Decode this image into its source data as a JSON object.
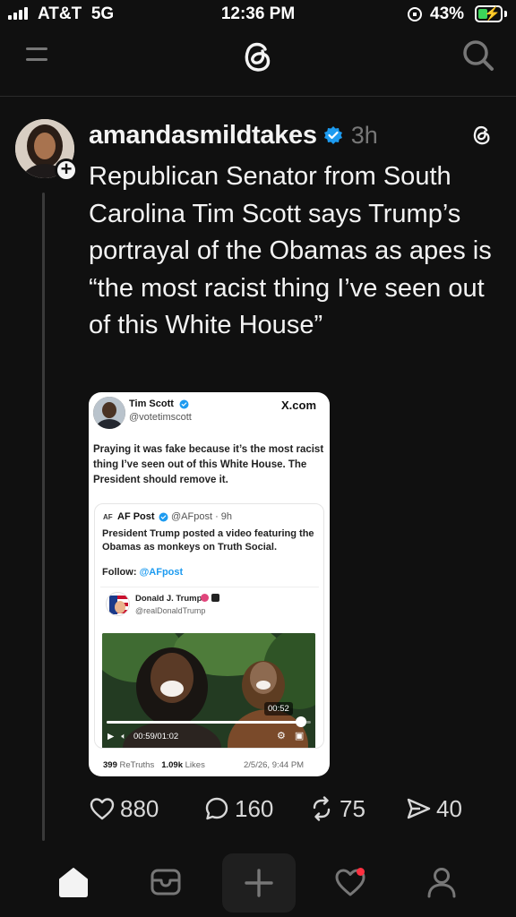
{
  "status_bar": {
    "carrier": "AT&T",
    "network": "5G",
    "time": "12:36 PM",
    "battery_pct": "43%",
    "battery_level": 0.43,
    "signal_icon": "cellular-signal-icon",
    "rotation_lock_icon": "rotation-lock-icon",
    "battery_icon": "battery-charging-icon"
  },
  "header": {
    "menu_icon": "hamburger-menu-icon",
    "logo_icon": "threads-logo-icon",
    "search_icon": "search-icon"
  },
  "post": {
    "username": "amandasmildtakes",
    "verified": true,
    "time": "3h",
    "text": "Republican Senator from South Carolina Tim Scott says Trump’s portrayal of the Obamas as apes is “the most racist thing I’ve seen out of this White House”",
    "embed": {
      "author_name": "Tim Scott",
      "author_handle": "@votetimscott",
      "source": "X.com",
      "text": "Praying it was fake because it’s the most racist thing I’ve seen out of this White House. The President should remove it.",
      "quote": {
        "logo": "AF",
        "name": "AF Post",
        "handle_time": "@AFpost · 9h",
        "text": "President Trump posted a video featuring the Obamas as monkeys on Truth Social.",
        "follow_label": "Follow:",
        "follow_link": "@AFpost",
        "inner": {
          "name": "Donald J. Trump",
          "handle": "@realDonaldTrump",
          "video": {
            "duration_badge": "00:52",
            "time": "00:59/01:02",
            "progress": 0.95
          }
        }
      },
      "retruths": "399",
      "retruths_label": "ReTruths",
      "likes": "1.09k",
      "likes_label": "Likes",
      "date": "2/5/26, 9:44 PM"
    },
    "actions": {
      "likes": "880",
      "replies": "160",
      "reposts": "75",
      "shares": "40"
    }
  },
  "tabbar": {
    "items": [
      {
        "name": "home",
        "icon": "home-icon"
      },
      {
        "name": "messages",
        "icon": "inbox-icon"
      },
      {
        "name": "create",
        "icon": "plus-icon"
      },
      {
        "name": "activity",
        "icon": "heart-icon"
      },
      {
        "name": "profile",
        "icon": "person-icon"
      }
    ]
  },
  "colors": {
    "background": "#101010",
    "text": "#f3f3f3",
    "muted": "#777777",
    "verified": "#1d9bf0",
    "notification": "#ff3040",
    "battery": "#3cd45a"
  }
}
